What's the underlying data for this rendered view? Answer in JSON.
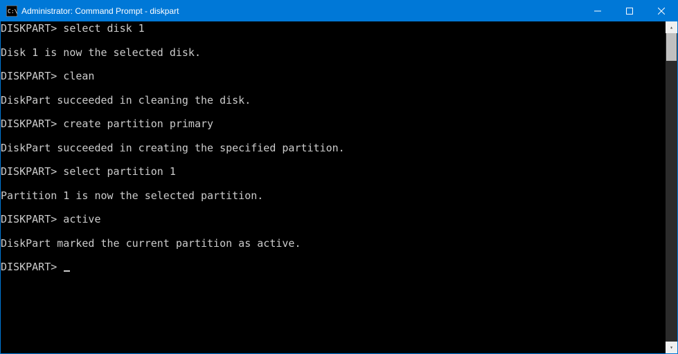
{
  "window": {
    "title": "Administrator: Command Prompt - diskpart"
  },
  "terminal": {
    "prompt": "DISKPART>",
    "entries": [
      {
        "cmd": "select disk 1",
        "out": "Disk 1 is now the selected disk."
      },
      {
        "cmd": "clean",
        "out": "DiskPart succeeded in cleaning the disk."
      },
      {
        "cmd": "create partition primary",
        "out": "DiskPart succeeded in creating the specified partition."
      },
      {
        "cmd": "select partition 1",
        "out": "Partition 1 is now the selected partition."
      },
      {
        "cmd": "active",
        "out": "DiskPart marked the current partition as active."
      }
    ]
  }
}
